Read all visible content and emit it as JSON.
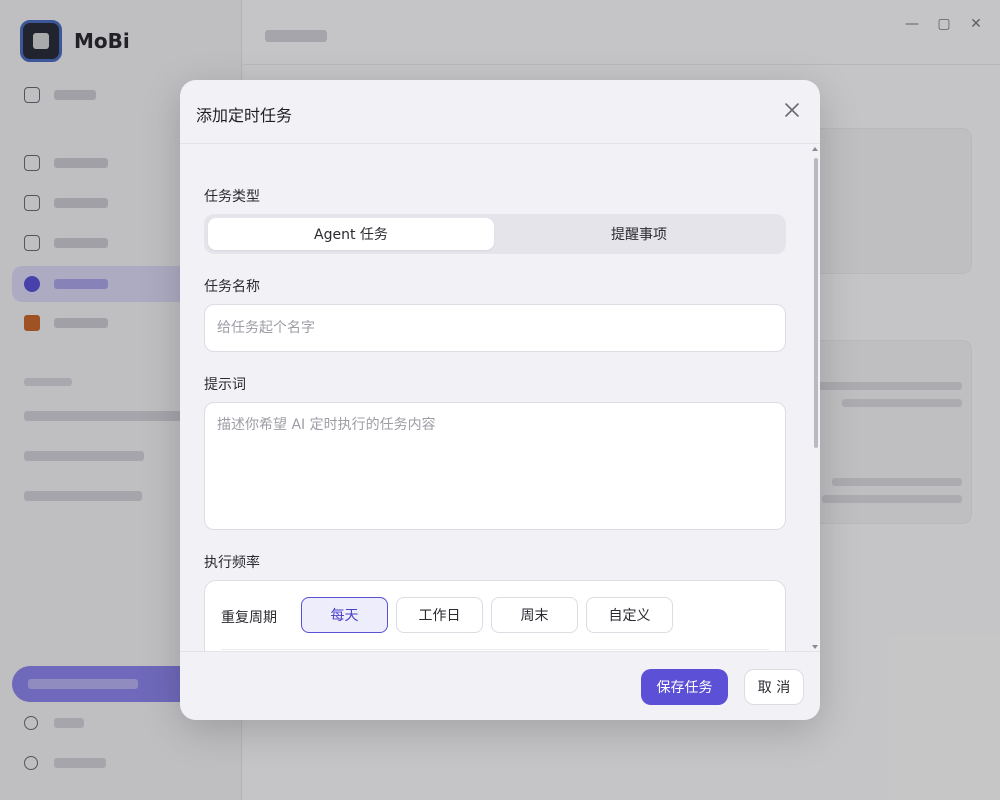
{
  "app": {
    "name": "MoBi"
  },
  "window_controls": {
    "minimize": "—",
    "maximize": "▢",
    "close": "✕"
  },
  "dialog": {
    "title": "添加定时任务",
    "close_icon": "close-icon",
    "task_type": {
      "label": "任务类型",
      "options": [
        "Agent 任务",
        "提醒事项"
      ],
      "selected": "Agent 任务"
    },
    "task_name": {
      "label": "任务名称",
      "value": "",
      "placeholder": "给任务起个名字"
    },
    "prompt": {
      "label": "提示词",
      "value": "",
      "placeholder": "描述你希望 AI 定时执行的任务内容"
    },
    "frequency": {
      "label": "执行频率",
      "repeat_label": "重复周期",
      "options": [
        "每天",
        "工作日",
        "周末",
        "自定义"
      ],
      "selected": "每天"
    },
    "footer": {
      "save_label": "保存任务",
      "cancel_label": "取 消"
    }
  },
  "colors": {
    "accent": "#5b50d6",
    "selected_bg": "#eeedfb"
  }
}
